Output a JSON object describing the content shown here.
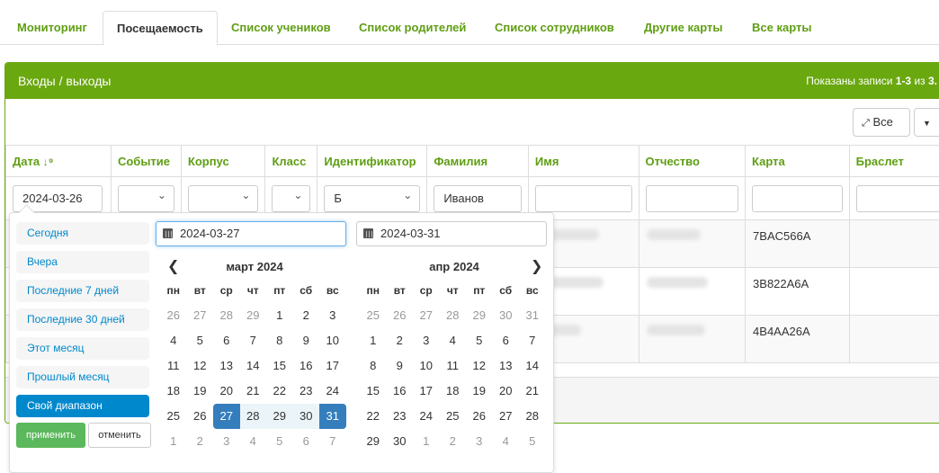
{
  "tabs": [
    "Мониторинг",
    "Посещаемость",
    "Список учеников",
    "Список родителей",
    "Список сотрудников",
    "Другие карты",
    "Все карты"
  ],
  "panel": {
    "title": "Входы / выходы",
    "summary_prefix": "Показаны записи ",
    "summary_range": "1-3",
    "summary_mid": " из ",
    "summary_total": "3."
  },
  "toolbar": {
    "expand_label": "Все"
  },
  "columns": [
    "Дата",
    "Событие",
    "Корпус",
    "Класс",
    "Идентификатор",
    "Фамилия",
    "Имя",
    "Отчество",
    "Карта",
    "Браслет"
  ],
  "filters": {
    "date": "2024-03-26",
    "identifier": "Б",
    "lastname": "Иванов"
  },
  "rows": [
    {
      "card": "7BAC566A"
    },
    {
      "card": "3B822A6A"
    },
    {
      "card": "4B4AA26A"
    }
  ],
  "picker": {
    "ranges": [
      "Сегодня",
      "Вчера",
      "Последние 7 дней",
      "Последние 30 дней",
      "Этот месяц",
      "Прошлый месяц",
      "Свой диапазон"
    ],
    "apply": "применить",
    "cancel": "отменить",
    "start": "2024-03-27",
    "end": "2024-03-31",
    "left_month": "март 2024",
    "right_month": "апр 2024",
    "dow": [
      "пн",
      "вт",
      "ср",
      "чт",
      "пт",
      "сб",
      "вс"
    ],
    "left_days": [
      [
        "26",
        "27",
        "28",
        "29",
        "1",
        "2",
        "3"
      ],
      [
        "4",
        "5",
        "6",
        "7",
        "8",
        "9",
        "10"
      ],
      [
        "11",
        "12",
        "13",
        "14",
        "15",
        "16",
        "17"
      ],
      [
        "18",
        "19",
        "20",
        "21",
        "22",
        "23",
        "24"
      ],
      [
        "25",
        "26",
        "27",
        "28",
        "29",
        "30",
        "31"
      ],
      [
        "1",
        "2",
        "3",
        "4",
        "5",
        "6",
        "7"
      ]
    ],
    "right_days": [
      [
        "25",
        "26",
        "27",
        "28",
        "29",
        "30",
        "31"
      ],
      [
        "1",
        "2",
        "3",
        "4",
        "5",
        "6",
        "7"
      ],
      [
        "8",
        "9",
        "10",
        "11",
        "12",
        "13",
        "14"
      ],
      [
        "15",
        "16",
        "17",
        "18",
        "19",
        "20",
        "21"
      ],
      [
        "22",
        "23",
        "24",
        "25",
        "26",
        "27",
        "28"
      ],
      [
        "29",
        "30",
        "1",
        "2",
        "3",
        "4",
        "5"
      ]
    ],
    "colors": {
      "accent": "#6aa80f",
      "selected": "#357ebd",
      "link": "#08c",
      "apply": "#5cb85c"
    }
  }
}
